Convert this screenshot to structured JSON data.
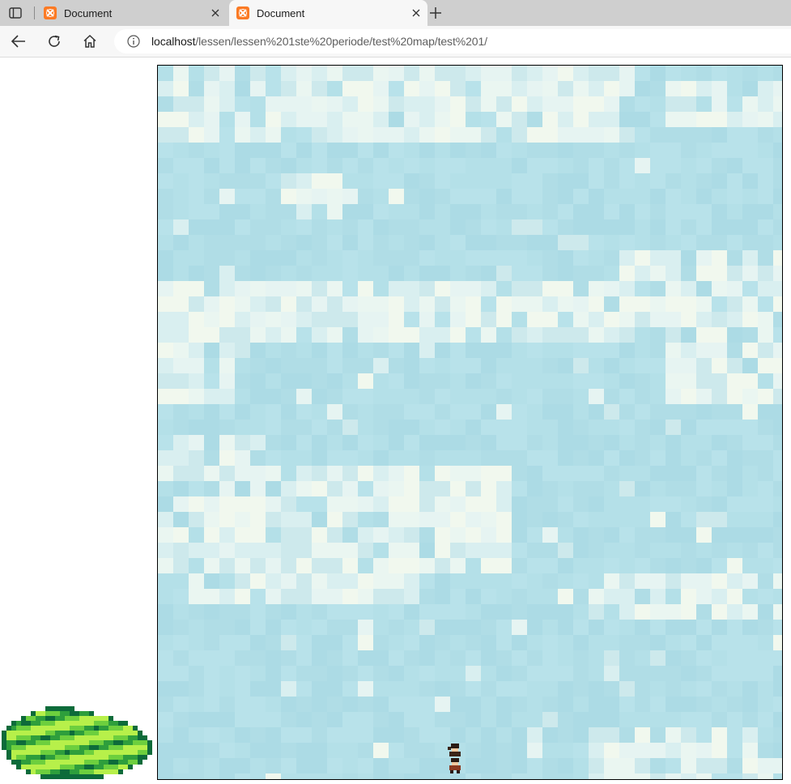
{
  "browser": {
    "tabs": [
      {
        "title": "Document",
        "active": false
      },
      {
        "title": "Document",
        "active": true
      }
    ],
    "address_bar": {
      "host": "localhost",
      "path": "/lessen/lessen%201ste%20periode/test%20map/test%201/"
    },
    "icons": {
      "tab_actions": "tab-actions-icon",
      "favicon": "xampp-icon",
      "close": "close-icon",
      "new_tab": "plus-icon",
      "back": "back-arrow-icon",
      "refresh": "refresh-icon",
      "home": "home-icon",
      "site_info": "info-icon"
    }
  },
  "page": {
    "map": {
      "description_colors": {
        "sky": "#b4e0e8",
        "cloud_light": "#e6f4f2",
        "cloud_bright": "#f1f8ee",
        "border": "#000000"
      }
    },
    "player_sprite": "player-character-icon",
    "bush_sprite": "bush-icon",
    "bush_colors": [
      "#0d6b3a",
      "#2e9e3c",
      "#6dcf3e",
      "#b7f04a"
    ]
  }
}
